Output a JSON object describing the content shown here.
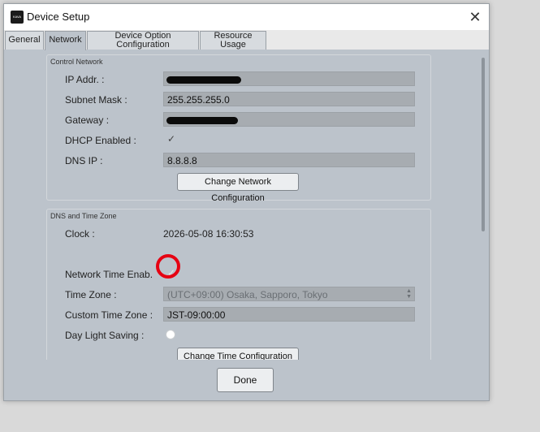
{
  "window": {
    "title": "Device Setup",
    "icon_text": "KAVA"
  },
  "tabs": [
    {
      "label": "General"
    },
    {
      "label": "Network"
    },
    {
      "label_line1": "Device Option",
      "label_line2": "Configuration"
    },
    {
      "label_line1": "Resource",
      "label_line2": "Usage"
    }
  ],
  "control_network": {
    "title": "Control Network",
    "ip_label": "IP Addr. :",
    "subnet_label": "Subnet Mask :",
    "subnet_value": "255.255.255.0",
    "gateway_label": "Gateway :",
    "dhcp_label": "DHCP Enabled :",
    "dhcp_checked": true,
    "dns_label": "DNS IP :",
    "dns_value": "8.8.8.8",
    "change_button": "Change Network Configuration"
  },
  "dns_time_zone": {
    "title": "DNS and Time Zone",
    "clock_label": "Clock :",
    "clock_value": "2026-05-08 16:30:53",
    "ntp_label": "Network Time Enab.",
    "ntp_checked": true,
    "timezone_label": "Time Zone :",
    "timezone_value": "(UTC+09:00) Osaka, Sapporo, Tokyo",
    "custom_tz_label": "Custom Time Zone :",
    "custom_tz_value": "JST-09:00:00",
    "dst_label": "Day Light Saving :",
    "change_button": "Change Time Configuration"
  },
  "done_button": "Done",
  "colors": {
    "highlight": "#e60012",
    "window_bg": "#bcc3cb",
    "field_bg": "#a7acb1"
  },
  "icons": {
    "check": "✓",
    "close": "✕"
  }
}
